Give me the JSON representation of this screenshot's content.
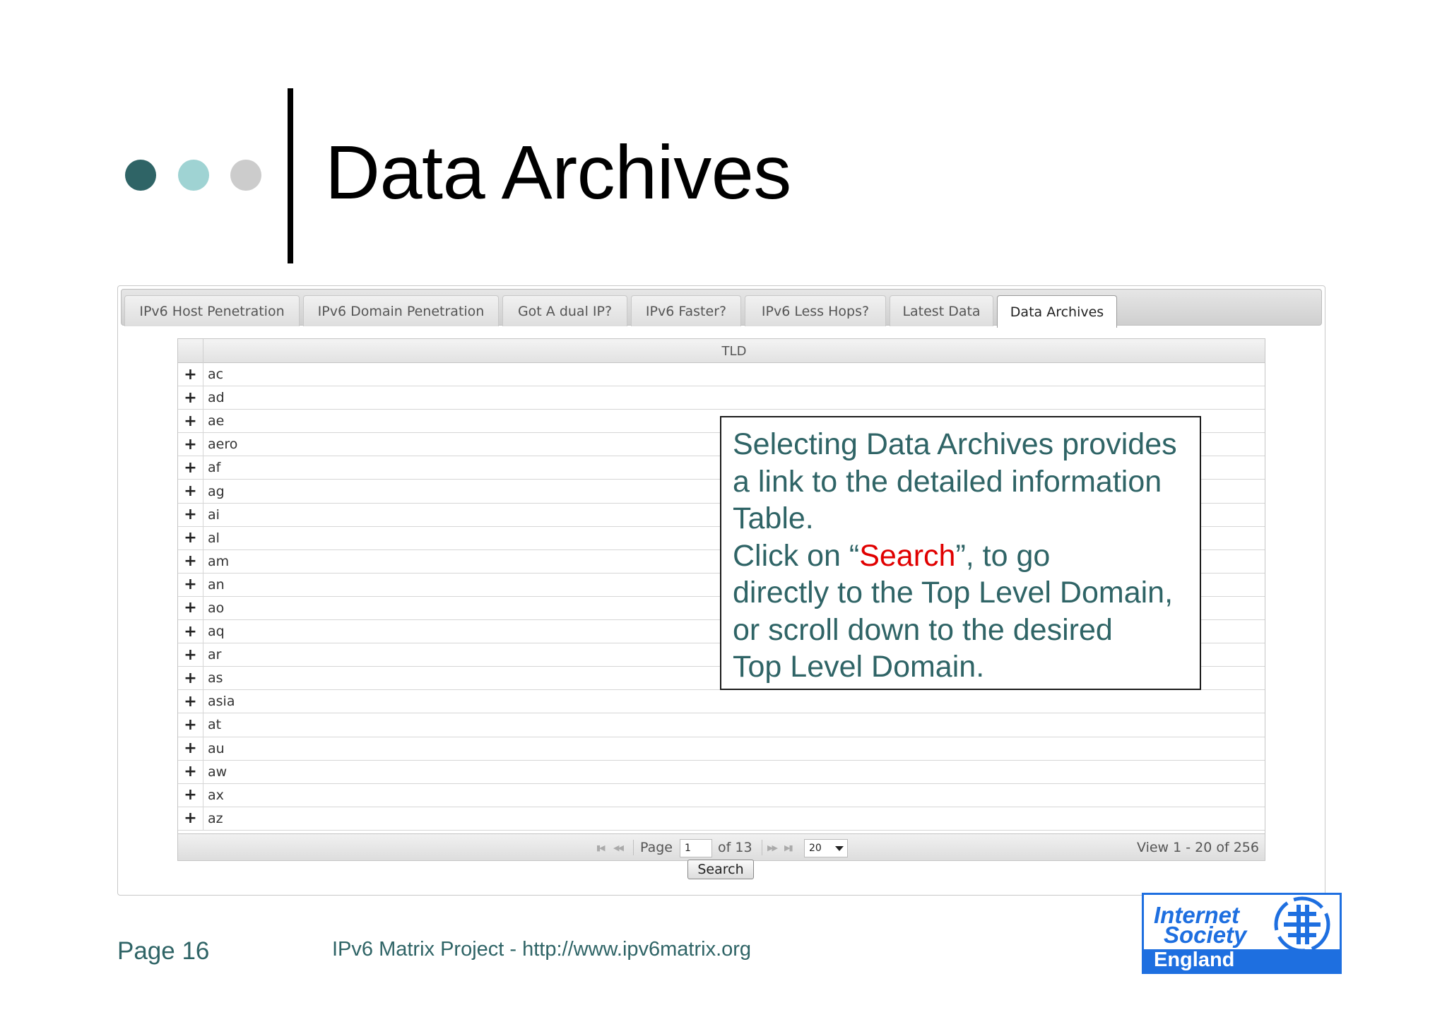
{
  "slide": {
    "title": "Data Archives",
    "page_label": "Page 16",
    "footer": "IPv6 Matrix Project - http://www.ipv6matrix.org"
  },
  "tabs": [
    {
      "label": "IPv6 Host Penetration",
      "active": false
    },
    {
      "label": "IPv6 Domain Penetration",
      "active": false
    },
    {
      "label": "Got A dual IP?",
      "active": false
    },
    {
      "label": "IPv6 Faster?",
      "active": false
    },
    {
      "label": "IPv6 Less Hops?",
      "active": false
    },
    {
      "label": "Latest Data",
      "active": false
    },
    {
      "label": "Data Archives",
      "active": true
    }
  ],
  "grid": {
    "column_header": "TLD",
    "expand_symbol": "+",
    "rows": [
      "ac",
      "ad",
      "ae",
      "aero",
      "af",
      "ag",
      "ai",
      "al",
      "am",
      "an",
      "ao",
      "aq",
      "ar",
      "as",
      "asia",
      "at",
      "au",
      "aw",
      "ax",
      "az"
    ],
    "pager": {
      "page_label": "Page",
      "page_value": "1",
      "of_label": "of 13",
      "rows_per_page": "20",
      "view_text": "View 1 - 20 of 256"
    }
  },
  "search_button": "Search",
  "callout": {
    "line1": "Selecting Data Archives provides",
    "line2": "a link to the detailed information",
    "line3": "Table.",
    "line4_pre": "Click on “",
    "line4_red": "Search",
    "line4_post": "”, to go",
    "line5": "directly to the Top Level Domain,",
    "line6": "or scroll down to the desired",
    "line7": "Top Level Domain."
  },
  "logo": {
    "line1": "Internet",
    "line2": "Society",
    "line3": "England"
  },
  "colors": {
    "accent": "#2f6466",
    "dot_light": "#9fd3d3",
    "dot_grey": "#cccccc",
    "highlight": "#e00000",
    "logo_blue": "#1e6fe0"
  }
}
